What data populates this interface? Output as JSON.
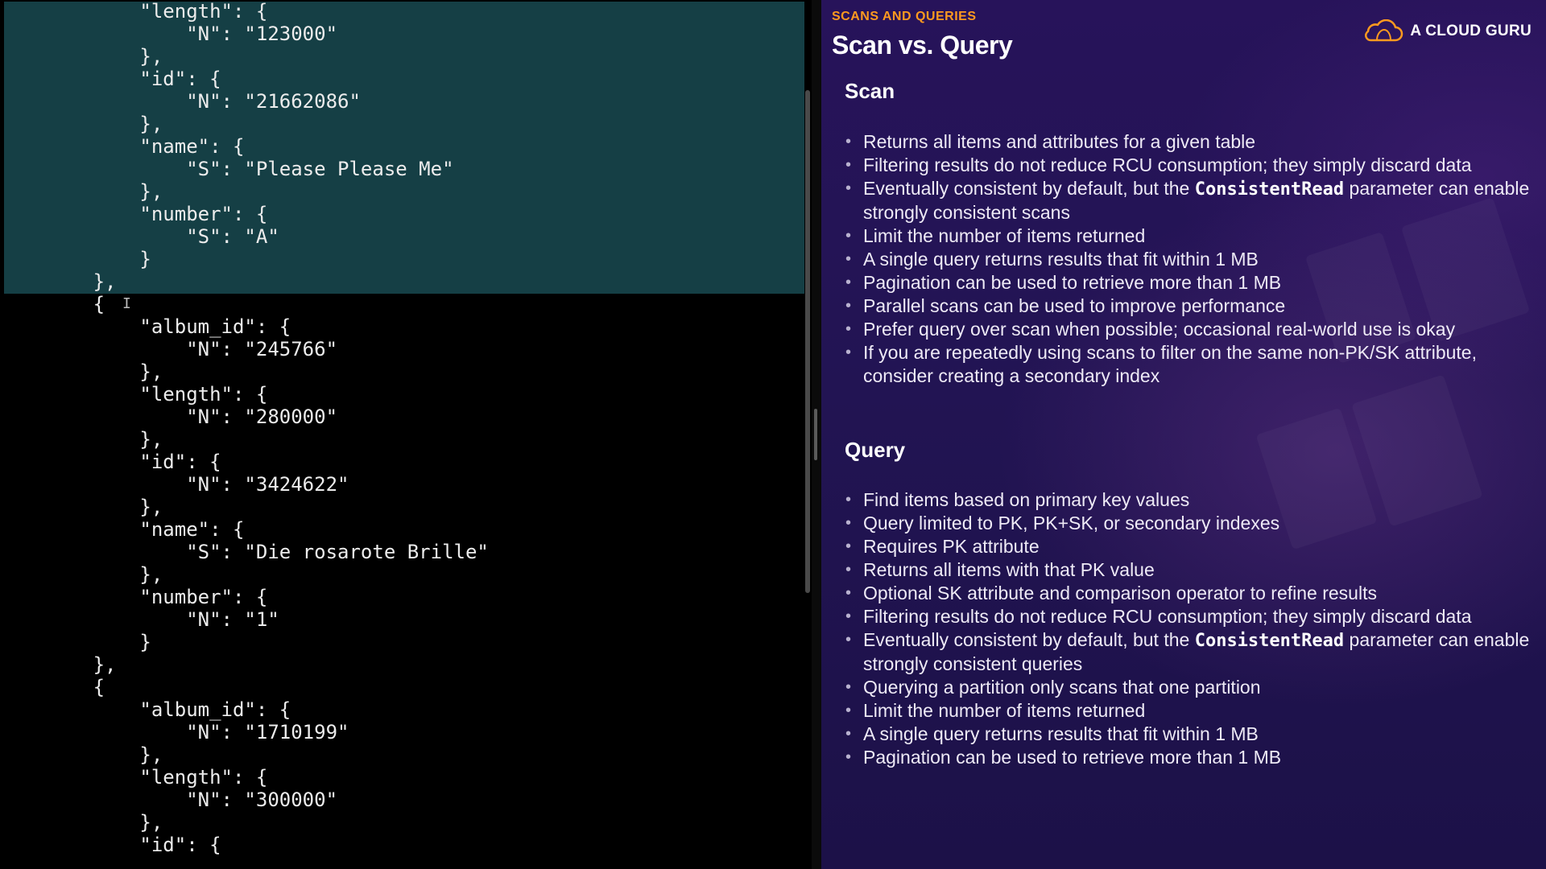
{
  "terminal": {
    "lines": [
      "            \"length\": {",
      "                \"N\": \"123000\"",
      "            },",
      "            \"id\": {",
      "                \"N\": \"21662086\"",
      "            },",
      "            \"name\": {",
      "                \"S\": \"Please Please Me\"",
      "            },",
      "            \"number\": {",
      "                \"S\": \"A\"",
      "            }",
      "        },",
      "        {",
      "            \"album_id\": {",
      "                \"N\": \"245766\"",
      "            },",
      "            \"length\": {",
      "                \"N\": \"280000\"",
      "            },",
      "            \"id\": {",
      "                \"N\": \"3424622\"",
      "            },",
      "            \"name\": {",
      "                \"S\": \"Die rosarote Brille\"",
      "            },",
      "            \"number\": {",
      "                \"N\": \"1\"",
      "            }",
      "        },",
      "        {",
      "            \"album_id\": {",
      "                \"N\": \"1710199\"",
      "            },",
      "            \"length\": {",
      "                \"N\": \"300000\"",
      "            },",
      "            \"id\": {"
    ],
    "cursor_glyph": "I"
  },
  "slide": {
    "eyebrow": "SCANS AND QUERIES",
    "title": "Scan vs. Query",
    "brand": "A CLOUD GURU",
    "brand_color": "#ff9a1f",
    "accent_color": "#ff9a1f",
    "bullet_glyph": "•",
    "scan": {
      "heading": "Scan",
      "items": [
        "Returns all items and attributes for a given table",
        "Filtering results do not reduce RCU consumption; they simply discard data",
        {
          "before": "Eventually consistent by default, but the ",
          "code": "ConsistentRead",
          "after": " parameter can enable strongly consistent scans"
        },
        "Limit the number of items returned",
        "A single query returns results that fit within 1 MB",
        "Pagination can be used to retrieve more than 1 MB",
        "Parallel scans can be used to improve performance",
        "Prefer query over scan when possible; occasional real-world use is okay",
        "If you are repeatedly using scans to filter on the same non-PK/SK attribute, consider creating a secondary index"
      ]
    },
    "query": {
      "heading": "Query",
      "items": [
        "Find items based on primary key values",
        "Query limited to PK, PK+SK, or secondary indexes",
        "Requires PK attribute",
        "Returns all items with that PK value",
        "Optional SK attribute and comparison operator to refine results",
        "Filtering results do not reduce RCU consumption; they simply discard data",
        {
          "before": "Eventually consistent by default, but the ",
          "code": "ConsistentRead",
          "after": " parameter can enable strongly consistent queries"
        },
        "Querying a partition only scans that one partition",
        "Limit the number of items returned",
        "A single query returns results that fit within 1 MB",
        "Pagination can be used to retrieve more than 1 MB"
      ]
    }
  }
}
